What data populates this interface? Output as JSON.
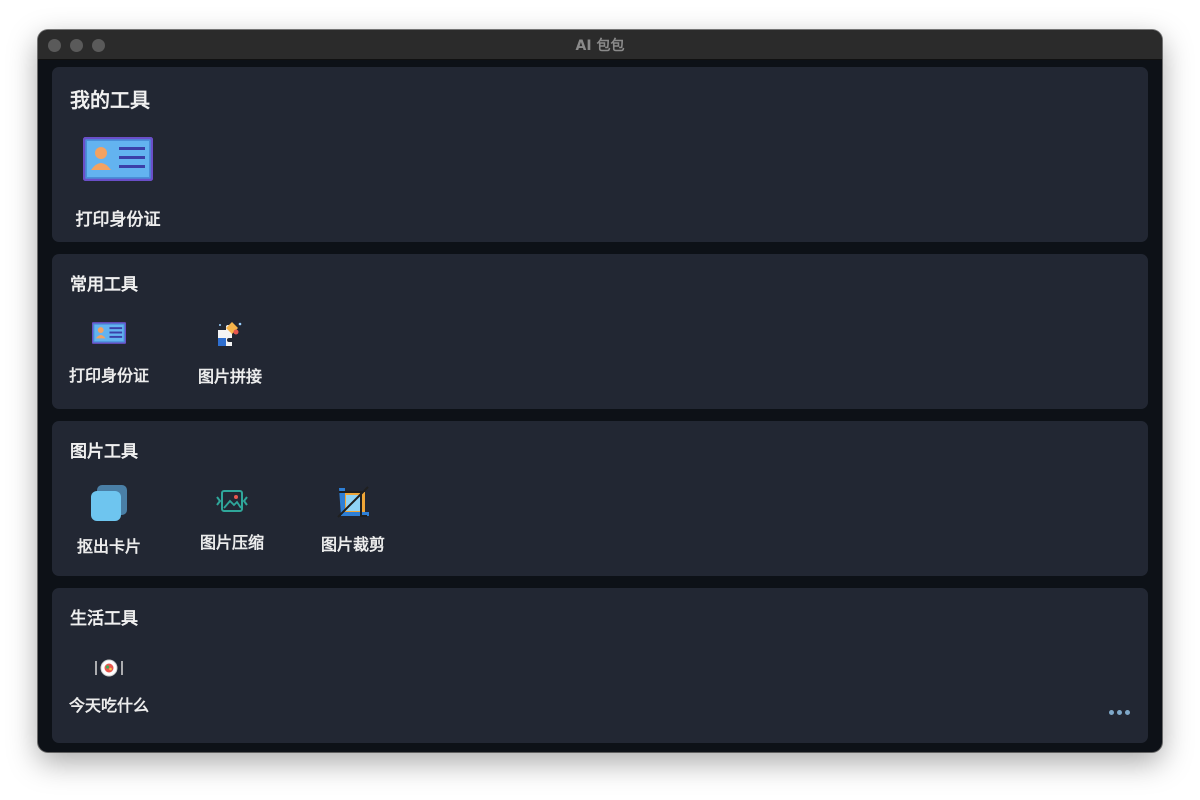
{
  "window": {
    "title": "AI 包包"
  },
  "sections": [
    {
      "title": "我的工具",
      "tools": [
        {
          "label": "打印身份证",
          "icon": "id-card-icon"
        }
      ]
    },
    {
      "title": "常用工具",
      "tools": [
        {
          "label": "打印身份证",
          "icon": "id-card-icon"
        },
        {
          "label": "图片拼接",
          "icon": "puzzle-icon"
        }
      ]
    },
    {
      "title": "图片工具",
      "tools": [
        {
          "label": "抠出卡片",
          "icon": "card-stack-icon"
        },
        {
          "label": "图片压缩",
          "icon": "image-compress-icon"
        },
        {
          "label": "图片裁剪",
          "icon": "crop-icon"
        }
      ]
    },
    {
      "title": "生活工具",
      "tools": [
        {
          "label": "今天吃什么",
          "icon": "food-plate-icon"
        }
      ]
    }
  ],
  "colors": {
    "card": "#222733",
    "background": "#0d1117",
    "accent": "#7fa8c9"
  }
}
